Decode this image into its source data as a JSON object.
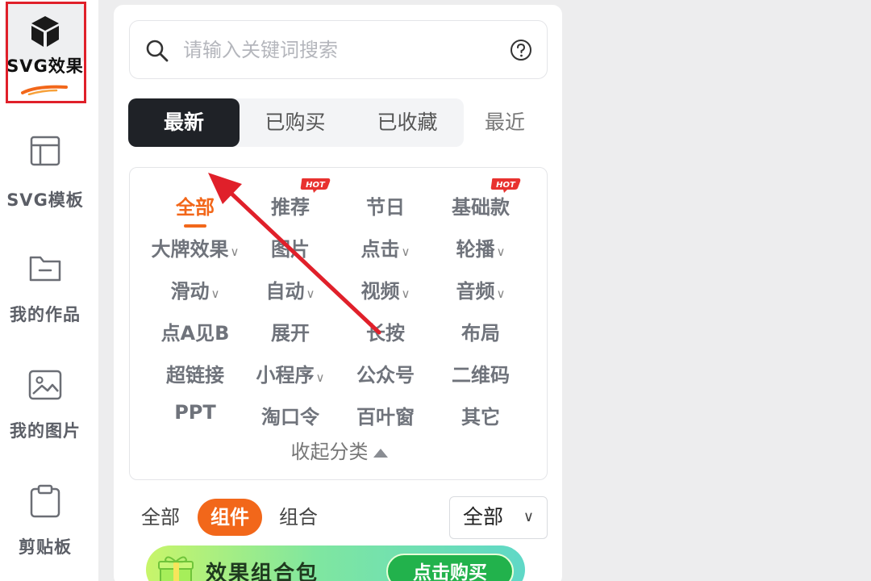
{
  "sidebar": {
    "items": [
      {
        "label": "SVG效果",
        "icon": "cube-icon",
        "active": true
      },
      {
        "label": "SVG模板",
        "icon": "layout-icon"
      },
      {
        "label": "我的作品",
        "icon": "folder-icon"
      },
      {
        "label": "我的图片",
        "icon": "image-icon"
      },
      {
        "label": "剪贴板",
        "icon": "clipboard-icon"
      }
    ]
  },
  "search": {
    "placeholder": "请输入关键词搜索",
    "icon": "search-icon",
    "help_icon": "help-icon"
  },
  "tabs": [
    {
      "label": "最新",
      "active": true
    },
    {
      "label": "已购买"
    },
    {
      "label": "已收藏"
    }
  ],
  "recent_tab": "最近",
  "categories": {
    "rows": [
      [
        "全部",
        "推荐",
        "节日",
        "基础款"
      ],
      [
        "大牌效果",
        "图片",
        "点击",
        "轮播"
      ],
      [
        "滑动",
        "自动",
        "视频",
        "音频"
      ],
      [
        "点A见B",
        "展开",
        "长按",
        "布局"
      ],
      [
        "超链接",
        "小程序",
        "公众号",
        "二维码"
      ],
      [
        "PPT",
        "淘口令",
        "百叶窗",
        "其它"
      ]
    ],
    "selected": "全部",
    "hot_badge": "HOT",
    "hot_items": [
      "推荐",
      "基础款"
    ],
    "dropdown_items": [
      "大牌效果",
      "点击",
      "轮播",
      "滑动",
      "自动",
      "视频",
      "音频",
      "小程序"
    ],
    "collapse_label": "收起分类"
  },
  "filters": [
    {
      "label": "全部"
    },
    {
      "label": "组件",
      "active": true
    },
    {
      "label": "组合"
    }
  ],
  "filter_select": {
    "value": "全部"
  },
  "banner": {
    "title": "效果组合包",
    "button": "点击购买"
  },
  "colors": {
    "accent": "#f2671a",
    "dark_tab": "#1f2227",
    "annotation": "#e0202a",
    "banner_button": "#22b24c"
  }
}
